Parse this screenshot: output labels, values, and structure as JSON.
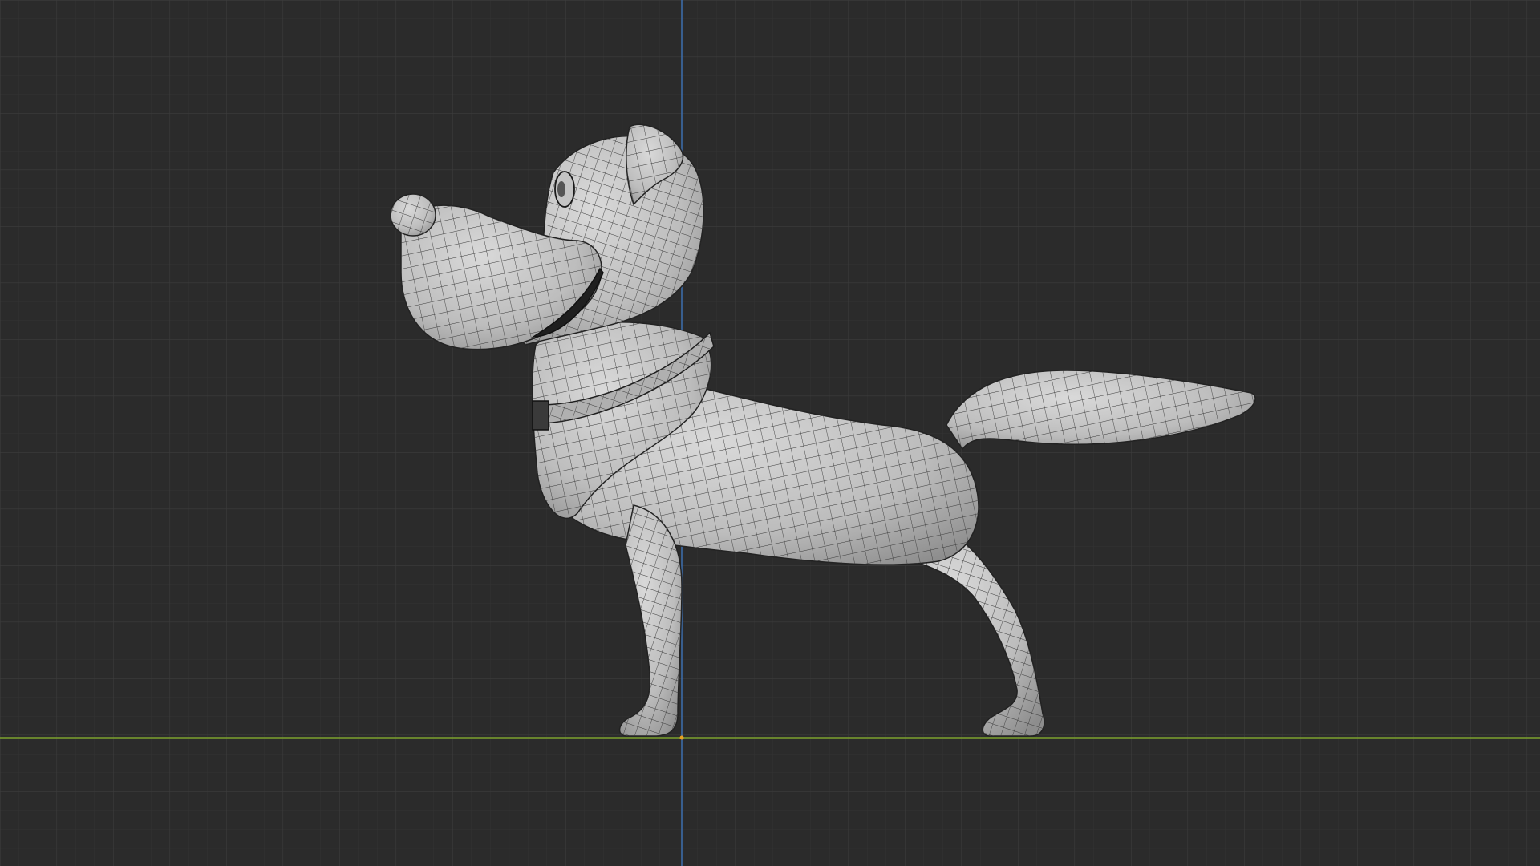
{
  "viewport": {
    "view": "side-orthographic",
    "background_color": "#2b2b2b",
    "grid": {
      "minor_color": "#383838",
      "major_color": "#404040"
    },
    "axes": {
      "x_axis_color": "#7da12e",
      "z_axis_color": "#3d6fb0"
    },
    "origin_marker_color": "#e8a020"
  },
  "model": {
    "subject": "cartoon-dog",
    "shading": "solid-with-wireframe",
    "surface_color": "#c9c9c9",
    "wire_color": "#2a2a2a"
  }
}
